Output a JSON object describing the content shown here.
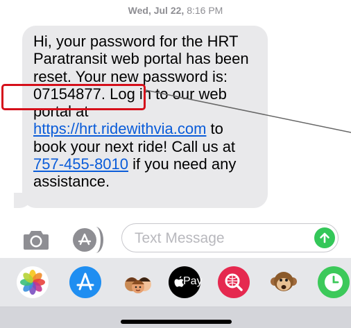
{
  "timestamp": {
    "day": "Wed, Jul 22,",
    "time": "8:16 PM"
  },
  "message": {
    "part1": "Hi, your password for the HRT Paratransit web portal has been reset. Your new password is: 07154877. Log in to our web portal at ",
    "link_url_text": "https://hrt.ridewithvia.com",
    "part2": " to book your next ride! Call us at ",
    "phone_text": "757-455-8010",
    "part3": " if you need any assistance."
  },
  "input_bar": {
    "placeholder": "Text Message"
  },
  "app_drawer": {
    "apps": [
      {
        "name": "Photos",
        "icon": "photos-icon"
      },
      {
        "name": "App Store",
        "icon": "app-store-icon"
      },
      {
        "name": "Memoji",
        "icon": "memoji-icon"
      },
      {
        "name": "Apple Pay",
        "label": "Pay",
        "icon": "apple-pay-icon"
      },
      {
        "name": "Web Search",
        "icon": "web-search-icon"
      },
      {
        "name": "Animoji",
        "icon": "animoji-monkey-icon"
      },
      {
        "name": "Clock",
        "icon": "clock-icon"
      }
    ]
  },
  "colors": {
    "bubble_gray": "#e9e9eb",
    "link_blue": "#0a5cd9",
    "annotation_red": "#d50f1a",
    "send_green": "#34c759"
  }
}
